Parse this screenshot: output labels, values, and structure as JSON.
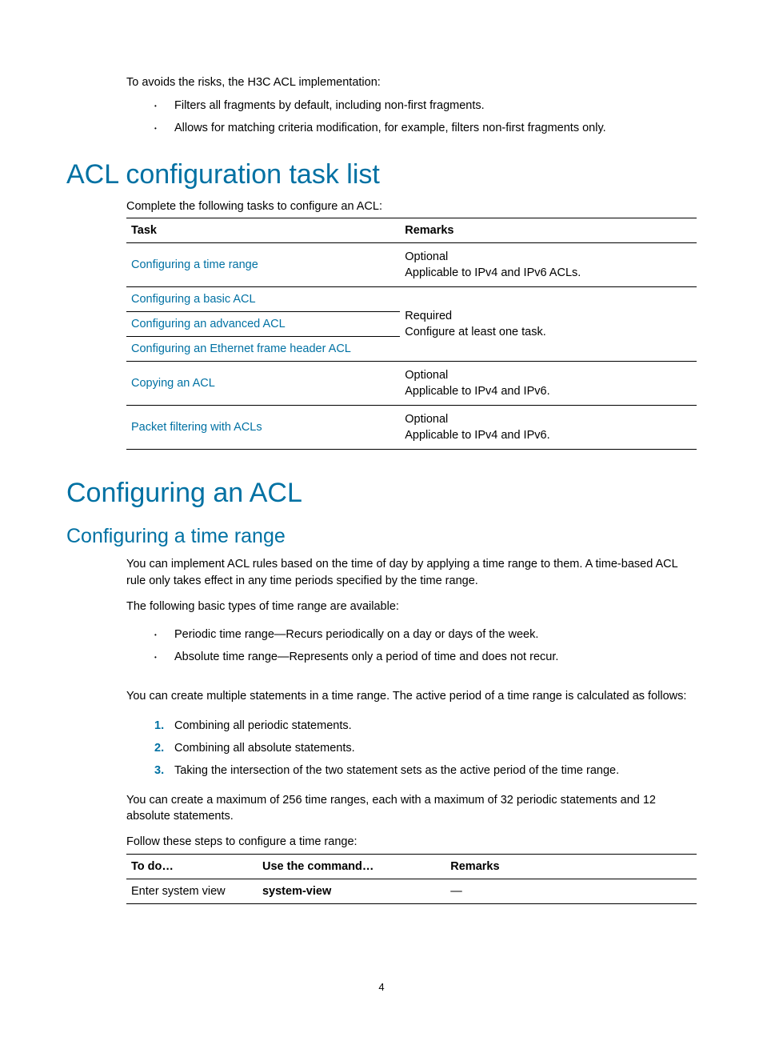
{
  "intro": "To avoids the risks, the H3C ACL implementation:",
  "intro_bullets": [
    "Filters all fragments by default, including non-first fragments.",
    "Allows for matching criteria modification, for example, filters non-first fragments only."
  ],
  "h1_tasklist": "ACL configuration task list",
  "tasklist_intro": "Complete the following tasks to configure an ACL:",
  "task_table": {
    "headers": {
      "task": "Task",
      "remarks": "Remarks"
    },
    "r1": {
      "task": "Configuring a time range",
      "rem1": "Optional",
      "rem2": "Applicable to IPv4 and IPv6 ACLs."
    },
    "r2": {
      "task": "Configuring a basic ACL"
    },
    "r3": {
      "task": "Configuring an advanced ACL",
      "rem1": "Required",
      "rem2": "Configure at least one task."
    },
    "r4": {
      "task": "Configuring an Ethernet frame header ACL"
    },
    "r5": {
      "task": "Copying an ACL",
      "rem1": "Optional",
      "rem2": "Applicable to IPv4 and IPv6."
    },
    "r6": {
      "task": "Packet filtering with ACLs",
      "rem1": "Optional",
      "rem2": "Applicable to IPv4 and IPv6."
    }
  },
  "h1_configuring": "Configuring an ACL",
  "h2_timerange": "Configuring a time range",
  "tr_para1": "You can implement ACL rules based on the time of day by applying a time range to them. A time-based ACL rule only takes effect in any time periods specified by the time range.",
  "tr_para2": "The following basic types of time range are available:",
  "tr_bullets": [
    "Periodic time range—Recurs periodically on a day or days of the week.",
    "Absolute time range—Represents only a period of time and does not recur."
  ],
  "tr_para3": "You can create multiple statements in a time range. The active period of a time range is calculated as follows:",
  "tr_steps": [
    "Combining all periodic statements.",
    "Combining all absolute statements.",
    "Taking the intersection of the two statement sets as the active period of the time range."
  ],
  "tr_para4": "You can create a maximum of 256 time ranges, each with a maximum of 32 periodic statements and 12 absolute statements.",
  "tr_para5": "Follow these steps to configure a time range:",
  "cmd_table": {
    "headers": {
      "todo": "To do…",
      "cmd": "Use the command…",
      "remarks": "Remarks"
    },
    "r1": {
      "todo": "Enter system view",
      "cmd": "system-view",
      "remarks": "—"
    }
  },
  "page_number": "4"
}
